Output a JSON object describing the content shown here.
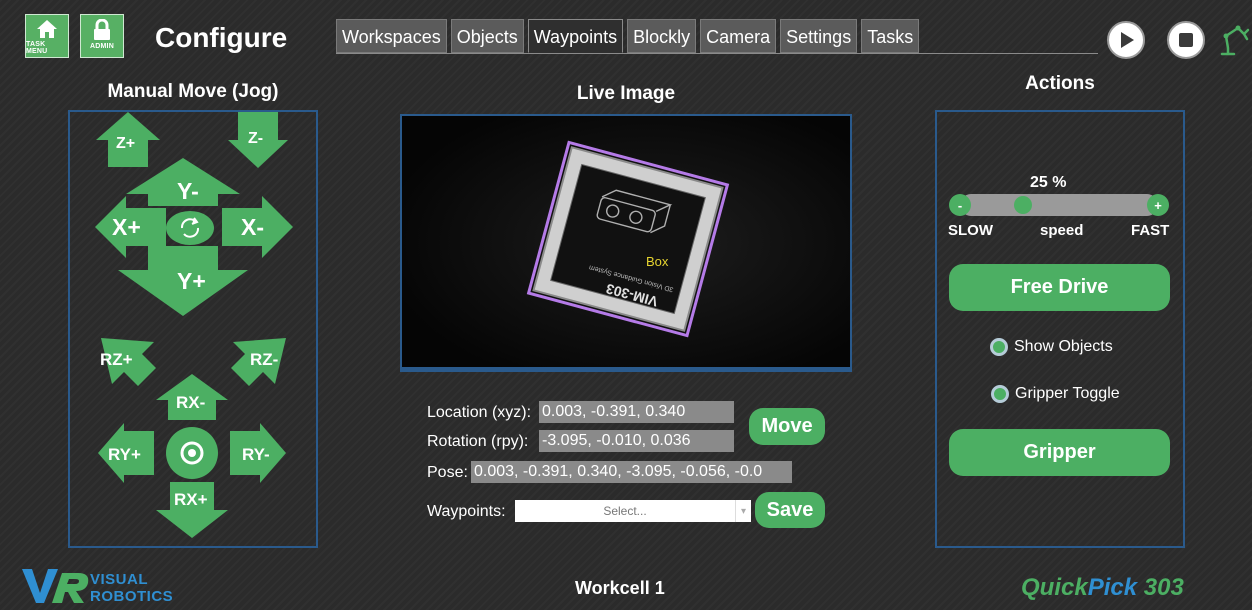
{
  "header": {
    "task_menu_label": "TASK MENU",
    "admin_label": "ADMIN",
    "title": "Configure",
    "tabs": [
      "Workspaces",
      "Objects",
      "Waypoints",
      "Blockly",
      "Camera",
      "Settings",
      "Tasks"
    ],
    "active_tab": "Waypoints",
    "icons": [
      "home-icon",
      "lock-icon",
      "play-icon",
      "stop-icon",
      "robot-arm-icon"
    ]
  },
  "jog": {
    "title": "Manual Move (Jog)",
    "labels": {
      "z_plus": "Z+",
      "z_minus": "Z-",
      "y_minus": "Y-",
      "y_plus": "Y+",
      "x_plus": "X+",
      "x_minus": "X-",
      "rz_plus": "RZ+",
      "rz_minus": "RZ-",
      "rx_minus": "RX-",
      "rx_plus": "RX+",
      "ry_plus": "RY+",
      "ry_minus": "RY-"
    }
  },
  "live": {
    "title": "Live Image",
    "object_label": "Box",
    "camera_text_1": "VIM-303",
    "camera_text_2": "3D Vision Guidance System"
  },
  "coords": {
    "location_label": "Location (xyz):",
    "location_value": "0.003, -0.391, 0.340",
    "rotation_label": "Rotation (rpy):",
    "rotation_value": "-3.095, -0.010, 0.036",
    "pose_label": "Pose:",
    "pose_value": "0.003, -0.391, 0.340, -3.095, -0.056, -0.0",
    "move_label": "Move",
    "waypoints_label": "Waypoints:",
    "waypoints_placeholder": "Select...",
    "save_label": "Save"
  },
  "actions": {
    "title": "Actions",
    "speed_percent": "25 %",
    "speed_value": 0.25,
    "minus": "-",
    "plus": "+",
    "slow": "SLOW",
    "speed": "speed",
    "fast": "FAST",
    "free_drive": "Free Drive",
    "show_objects": "Show Objects",
    "gripper_toggle": "Gripper Toggle",
    "gripper": "Gripper"
  },
  "footer": {
    "workcell": "Workcell 1",
    "logo_top": "VISUAL",
    "logo_bottom": "ROBOTICS",
    "brand_a": "Quick",
    "brand_b": "Pick",
    "brand_c": " 303"
  },
  "colors": {
    "accent_green": "#4caf63",
    "panel_border": "#2a5a8c",
    "brand_blue": "#2f8fd2",
    "background": "#2b2b2b"
  }
}
